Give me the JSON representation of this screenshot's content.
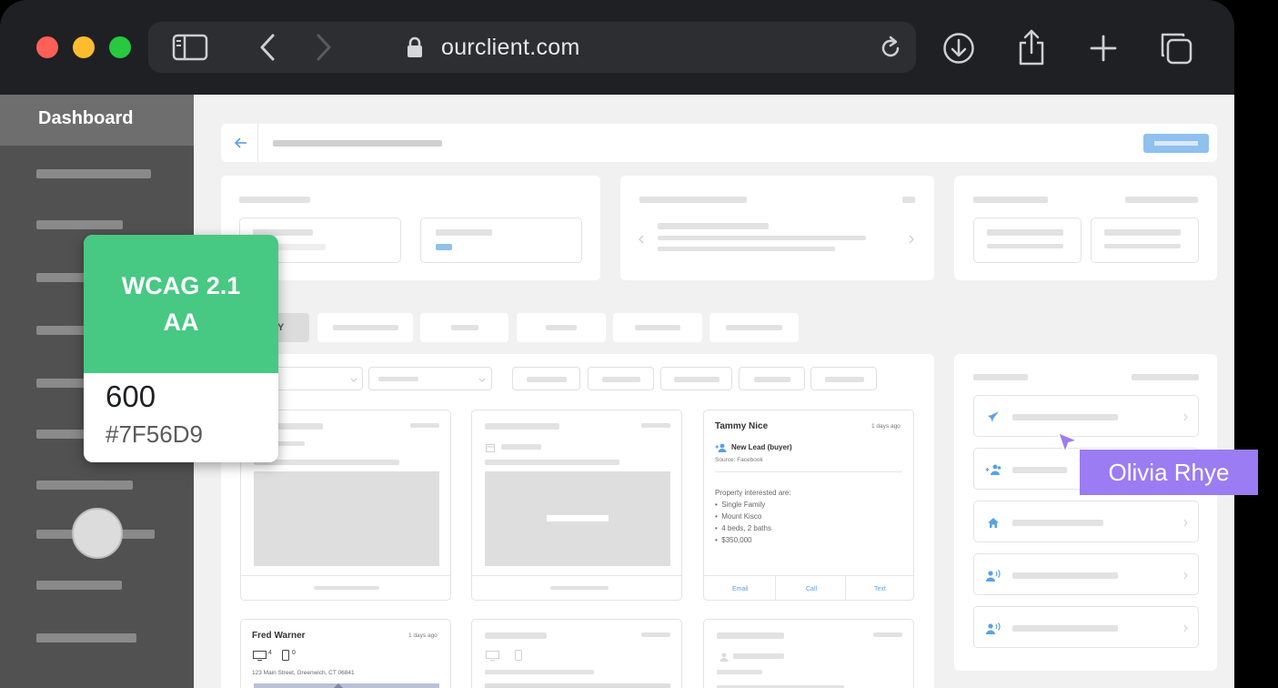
{
  "browser": {
    "url": "ourclient.com",
    "icons": [
      "sidebar-icon",
      "back-icon",
      "forward-icon",
      "lock-icon",
      "reload-icon",
      "download-icon",
      "share-icon",
      "new-tab-icon",
      "tabs-icon"
    ]
  },
  "sidebar": {
    "active_item": "Dashboard"
  },
  "lead_card": {
    "name": "Tammy Nice",
    "time": "1 days ago",
    "status": "New Lead (buyer)",
    "source": "Source: Facebook",
    "interest_heading": "Property interested are:",
    "interests": [
      "Single Family",
      "Mount Kisco",
      "4 beds, 2 baths",
      "$350,000"
    ],
    "actions": [
      "Email",
      "Call",
      "Text"
    ]
  },
  "property_card": {
    "name": "Fred Warner",
    "time": "1 days ago",
    "monitors": "4",
    "phones": "0",
    "address": "123 Main Street, Greenwich, CT 06841"
  },
  "badge": {
    "title_line1": "WCAG 2.1",
    "title_line2": "AA",
    "weight": "600",
    "hex": "#7F56D9",
    "color": "#47c883"
  },
  "cursor": {
    "name": "Olivia Rhye",
    "color": "#9b7cf2"
  },
  "tab_partial": "Y",
  "right_panel_icons": [
    "rocket-icon",
    "people-icon",
    "home-icon",
    "people-call-icon",
    "people-call-icon"
  ]
}
